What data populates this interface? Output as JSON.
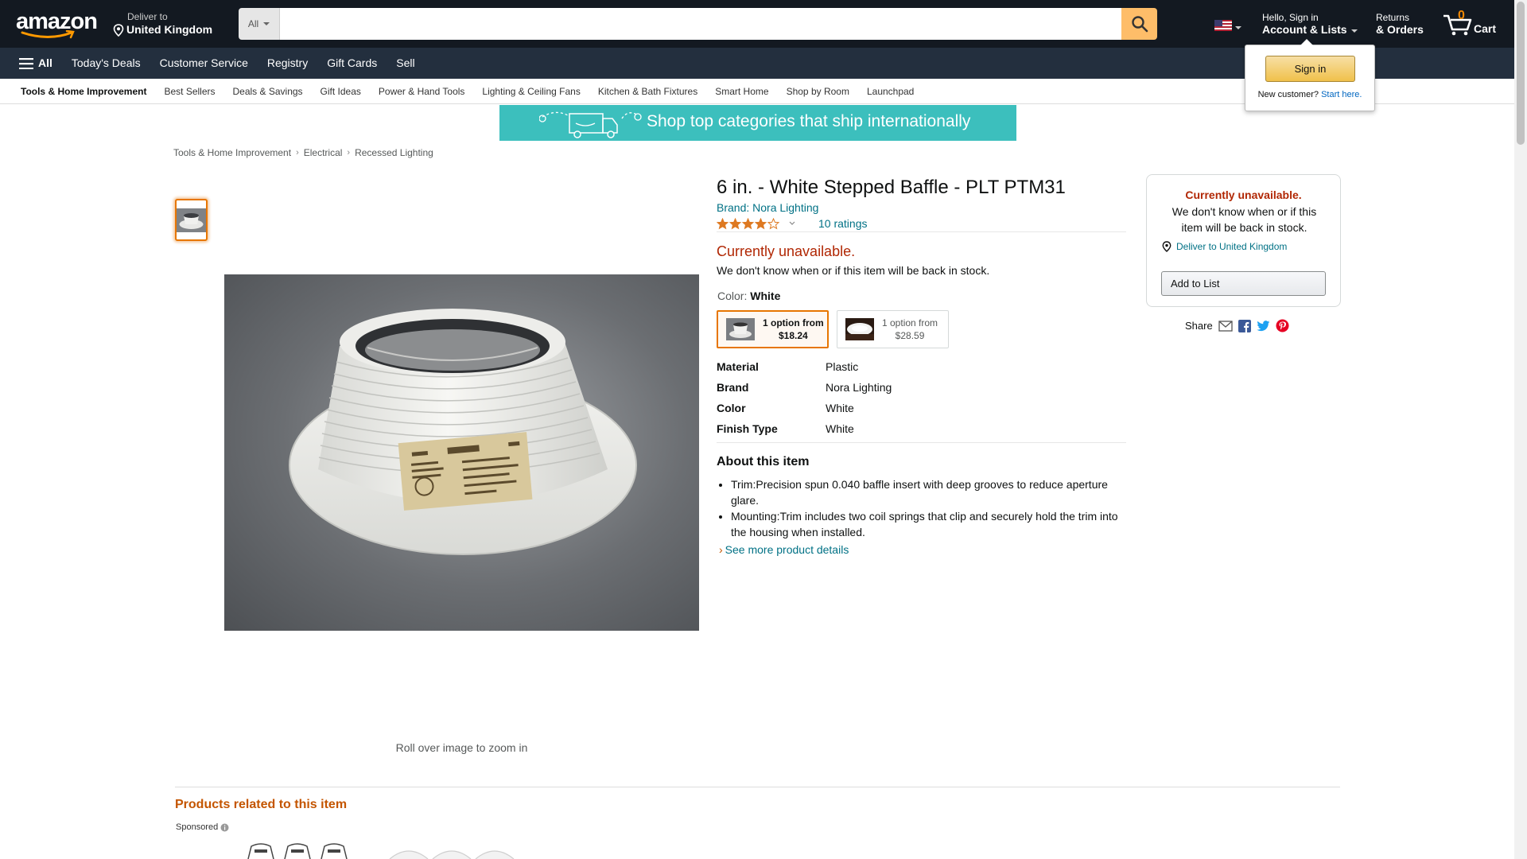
{
  "header": {
    "logo_text": "amazon",
    "deliver_small": "Deliver to",
    "deliver_big": "United Kingdom",
    "search_category": "All",
    "search_value": "",
    "account_small": "Hello, Sign in",
    "account_big": "Account & Lists",
    "returns_small": "Returns",
    "returns_big": "& Orders",
    "cart_count": "0",
    "cart_label": "Cart"
  },
  "main_nav": {
    "all_label": "All",
    "items": [
      "Today's Deals",
      "Customer Service",
      "Registry",
      "Gift Cards",
      "Sell"
    ]
  },
  "sub_nav": {
    "items": [
      "Tools & Home Improvement",
      "Best Sellers",
      "Deals & Savings",
      "Gift Ideas",
      "Power & Hand Tools",
      "Lighting & Ceiling Fans",
      "Kitchen & Bath Fixtures",
      "Smart Home",
      "Shop by Room",
      "Launchpad"
    ]
  },
  "banner": {
    "text": "Shop top categories that ship internationally"
  },
  "breadcrumb": [
    "Tools & Home Improvement",
    "Electrical",
    "Recessed Lighting"
  ],
  "product": {
    "title": "6 in. - White Stepped Baffle - PLT PTM31",
    "brand_link": "Brand: Nora Lighting",
    "rating": 4.0,
    "ratings_count": "10 ratings",
    "unavailable": "Currently unavailable.",
    "unavailable_sub": "We don't know when or if this item will be back in stock.",
    "color_label": "Color:",
    "color_value": "White",
    "swatches": [
      {
        "line1": "1 option from",
        "line2": "$18.24"
      },
      {
        "line1": "1 option from",
        "line2": "$28.59"
      }
    ],
    "specs": [
      {
        "k": "Material",
        "v": "Plastic"
      },
      {
        "k": "Brand",
        "v": "Nora Lighting"
      },
      {
        "k": "Color",
        "v": "White"
      },
      {
        "k": "Finish Type",
        "v": "White"
      }
    ],
    "about_heading": "About this item",
    "bullets": [
      "Trim:Precision spun 0.040 baffle insert with deep grooves to reduce aperture glare.",
      "Mounting:Trim includes two coil springs that clip and securely hold the trim into the housing when installed."
    ],
    "see_more": "See more product details",
    "zoom_hint": "Roll over image to zoom in"
  },
  "buybox": {
    "unavailable": "Currently unavailable.",
    "text": "We don't know when or if this item will be back in stock.",
    "deliver": "Deliver to United Kingdom",
    "add_to_list": "Add to List"
  },
  "share": {
    "label": "Share"
  },
  "related": {
    "heading": "Products related to this item",
    "sponsored": "Sponsored"
  },
  "signin_popover": {
    "button": "Sign in",
    "new_customer": "New customer?",
    "start_here": "Start here."
  },
  "colors": {
    "nav_dark": "#131921",
    "nav_mid": "#232f3e",
    "search_button": "#febd69",
    "unavailable_red": "#b12704",
    "link_teal": "#007185",
    "star_orange": "#de7921"
  }
}
